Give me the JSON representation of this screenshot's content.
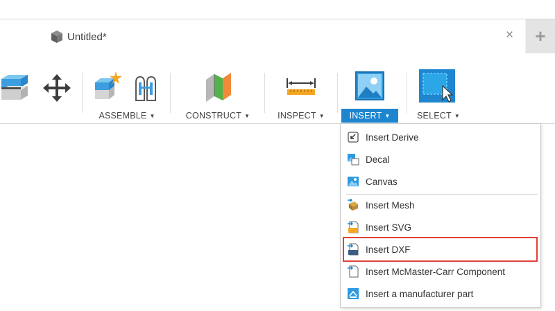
{
  "window": {
    "doc_tab_title": "Untitled*",
    "close_glyph": "×",
    "new_tab_glyph": "+"
  },
  "toolbar": {
    "groups": [
      {
        "label": "ASSEMBLE",
        "active": false
      },
      {
        "label": "CONSTRUCT",
        "active": false
      },
      {
        "label": "INSPECT",
        "active": false
      },
      {
        "label": "INSERT",
        "active": true
      },
      {
        "label": "SELECT",
        "active": false
      }
    ],
    "caret_glyph": "▼"
  },
  "insert_menu": {
    "items": [
      {
        "label": "Insert Derive",
        "icon": "insert-derive-icon"
      },
      {
        "label": "Decal",
        "icon": "decal-icon"
      },
      {
        "label": "Canvas",
        "icon": "canvas-icon"
      },
      {
        "label": "Insert Mesh",
        "icon": "insert-mesh-icon"
      },
      {
        "label": "Insert SVG",
        "icon": "insert-svg-icon"
      },
      {
        "label": "Insert DXF",
        "icon": "insert-dxf-icon",
        "highlighted": true
      },
      {
        "label": "Insert McMaster-Carr Component",
        "icon": "mcmaster-carr-icon"
      },
      {
        "label": "Insert a manufacturer part",
        "icon": "manufacturer-part-icon"
      }
    ]
  },
  "colors": {
    "accent_blue": "#1e86cf",
    "highlight_red": "#e0433c"
  }
}
